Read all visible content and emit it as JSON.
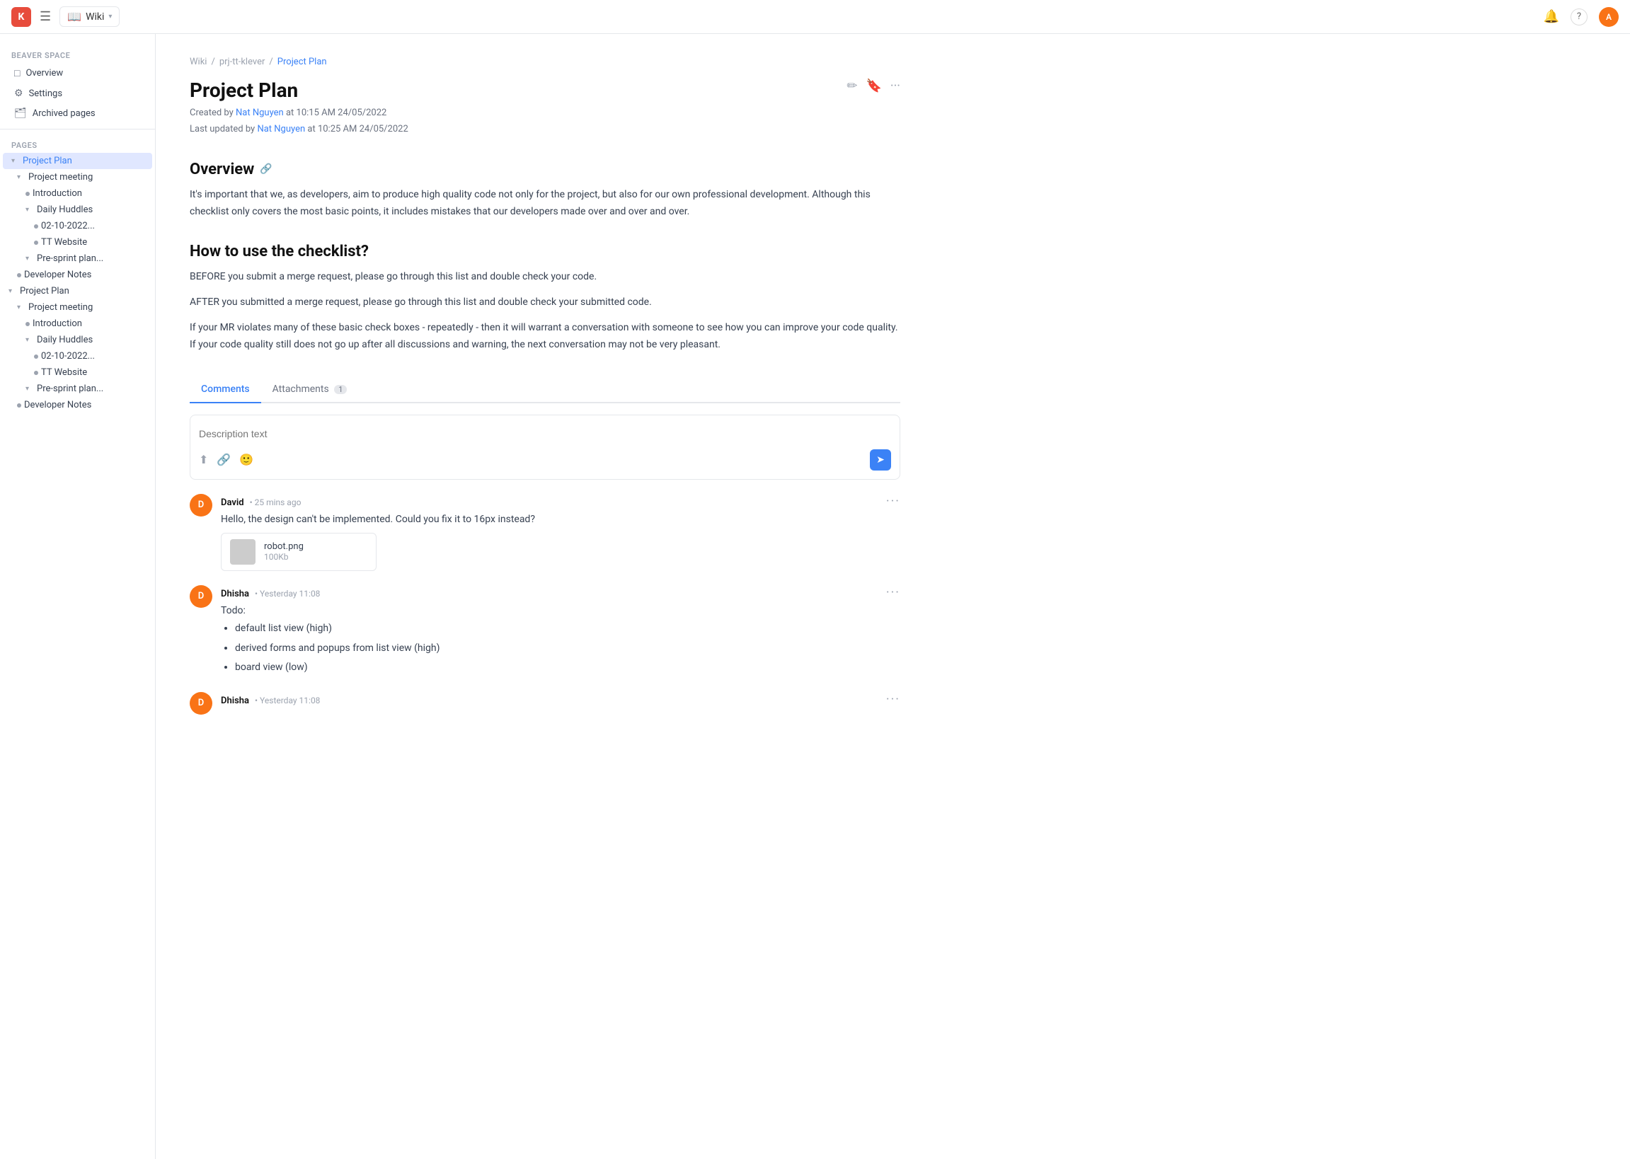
{
  "topnav": {
    "logo_text": "K",
    "wiki_label": "Wiki",
    "notification_icon": "🔔",
    "help_icon": "?",
    "avatar_text": "A"
  },
  "sidebar": {
    "space_label": "BEAVER SPACE",
    "overview_label": "Overview",
    "settings_label": "Settings",
    "archived_pages_label": "Archived pages",
    "pages_label": "PAGES",
    "tree": [
      {
        "id": "project-plan-1",
        "label": "Project Plan",
        "indent": 0,
        "type": "expand",
        "active": true
      },
      {
        "id": "project-meeting-1",
        "label": "Project meeting",
        "indent": 1,
        "type": "expand"
      },
      {
        "id": "introduction-1",
        "label": "Introduction",
        "indent": 2,
        "type": "dot"
      },
      {
        "id": "daily-huddles-1",
        "label": "Daily Huddles",
        "indent": 2,
        "type": "expand"
      },
      {
        "id": "02-10-2022-1",
        "label": "02-10-2022...",
        "indent": 3,
        "type": "dot"
      },
      {
        "id": "tt-website-1",
        "label": "TT Website",
        "indent": 3,
        "type": "dot"
      },
      {
        "id": "pre-sprint-1",
        "label": "Pre-sprint plan...",
        "indent": 2,
        "type": "expand"
      },
      {
        "id": "developer-notes-1",
        "label": "Developer Notes",
        "indent": 1,
        "type": "dot"
      },
      {
        "id": "project-plan-2",
        "label": "Project Plan",
        "indent": 0,
        "type": "expand"
      },
      {
        "id": "project-meeting-2",
        "label": "Project meeting",
        "indent": 1,
        "type": "expand"
      },
      {
        "id": "introduction-2",
        "label": "Introduction",
        "indent": 2,
        "type": "dot"
      },
      {
        "id": "daily-huddles-2",
        "label": "Daily Huddles",
        "indent": 2,
        "type": "expand"
      },
      {
        "id": "02-10-2022-2",
        "label": "02-10-2022...",
        "indent": 3,
        "type": "dot"
      },
      {
        "id": "tt-website-2",
        "label": "TT Website",
        "indent": 3,
        "type": "dot"
      },
      {
        "id": "pre-sprint-2",
        "label": "Pre-sprint plan...",
        "indent": 2,
        "type": "expand"
      },
      {
        "id": "developer-notes-2",
        "label": "Developer Notes",
        "indent": 1,
        "type": "dot"
      }
    ]
  },
  "breadcrumb": {
    "items": [
      {
        "label": "Wiki",
        "active": false
      },
      {
        "label": "prj-tt-klever",
        "active": false
      },
      {
        "label": "Project Plan",
        "active": true
      }
    ]
  },
  "page": {
    "title": "Project Plan",
    "created_by": "Created by",
    "created_author": "Nat Nguyen",
    "created_at": "at 10:15 AM 24/05/2022",
    "updated_by": "Last updated by",
    "updated_author": "Nat Nguyen",
    "updated_at": "at 10:25 AM 24/05/2022",
    "sections": [
      {
        "id": "overview",
        "heading": "Overview",
        "paragraphs": [
          "It's important that we, as developers, aim to produce high quality code not only for the project, but also for our own professional development. Although this checklist only covers the most basic points, it includes mistakes that our developers made over and over and over."
        ]
      },
      {
        "id": "checklist",
        "heading": "How to use the checklist?",
        "paragraphs": [
          "BEFORE you submit a merge request, please go through this list and double check your code.",
          "AFTER you submitted a merge request, please go through this list and double check your submitted code.",
          "If your MR violates many of these basic check boxes - repeatedly - then it will warrant a conversation with someone to see how you can improve your code quality. If your code quality still does not go up after all discussions and warning, the next conversation may not be very pleasant."
        ]
      }
    ]
  },
  "tabs": {
    "comments_label": "Comments",
    "attachments_label": "Attachments",
    "attachments_count": "1",
    "active_tab": "comments"
  },
  "comment_box": {
    "placeholder": "Description text",
    "send_icon": "➤"
  },
  "comments": [
    {
      "id": "comment-1",
      "avatar_text": "D",
      "avatar_color": "#f97316",
      "author": "David",
      "time": "25 mins ago",
      "text": "Hello, the design can't be implemented. Could you fix it to 16px instead?",
      "attachment": {
        "name": "robot.png",
        "size": "100Kb"
      }
    },
    {
      "id": "comment-2",
      "avatar_text": "D",
      "avatar_color": "#f97316",
      "author": "Dhisha",
      "time": "Yesterday 11:08",
      "text": "Todo:",
      "list_items": [
        "default list view (high)",
        "derived forms and popups from list view (high)",
        "board view (low)"
      ]
    },
    {
      "id": "comment-3",
      "avatar_text": "D",
      "avatar_color": "#f97316",
      "author": "Dhisha",
      "time": "Yesterday 11:08",
      "text": ""
    }
  ]
}
